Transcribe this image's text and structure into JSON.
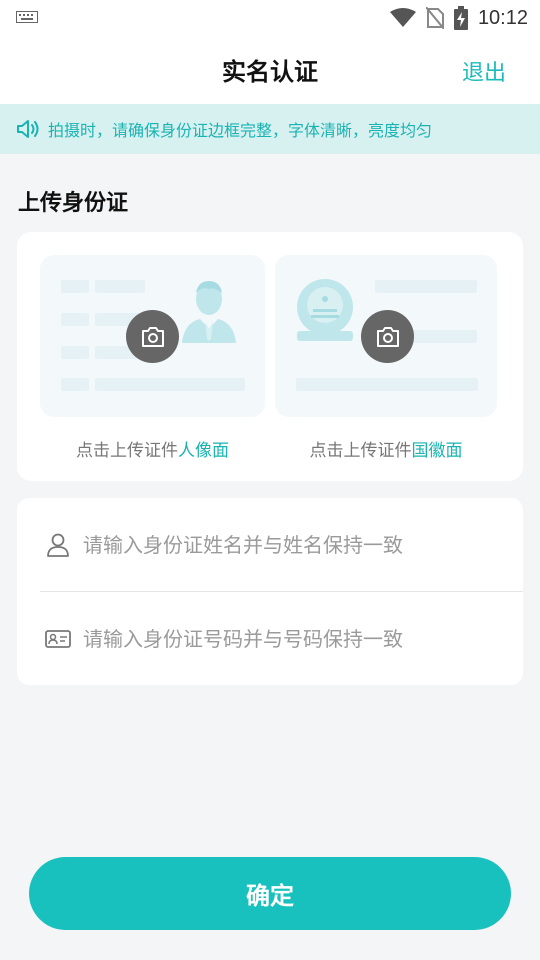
{
  "status_bar": {
    "time": "10:12",
    "icons": [
      "keyboard-icon",
      "wifi-icon",
      "no-sim-icon",
      "battery-charging-icon"
    ]
  },
  "header": {
    "title": "实名认证",
    "exit_label": "退出"
  },
  "notice": {
    "icon": "speaker-icon",
    "text": "拍摄时，请确保身份证边框完整，字体清晰，亮度均匀"
  },
  "upload": {
    "section_title": "上传身份证",
    "front": {
      "caption_prefix": "点击上传证件",
      "caption_highlight": "人像面",
      "icon": "camera-icon"
    },
    "back": {
      "caption_prefix": "点击上传证件",
      "caption_highlight": "国徽面",
      "icon": "camera-icon"
    }
  },
  "form": {
    "name_placeholder": "请输入身份证姓名并与姓名保持一致",
    "name_value": "",
    "name_icon": "person-icon",
    "id_placeholder": "请输入身份证号码并与号码保持一致",
    "id_value": "",
    "id_icon": "id-card-icon"
  },
  "confirm_label": "确定",
  "colors": {
    "accent": "#1bb3b2",
    "button": "#19c1be",
    "notice_bg": "#d7f1f1"
  }
}
